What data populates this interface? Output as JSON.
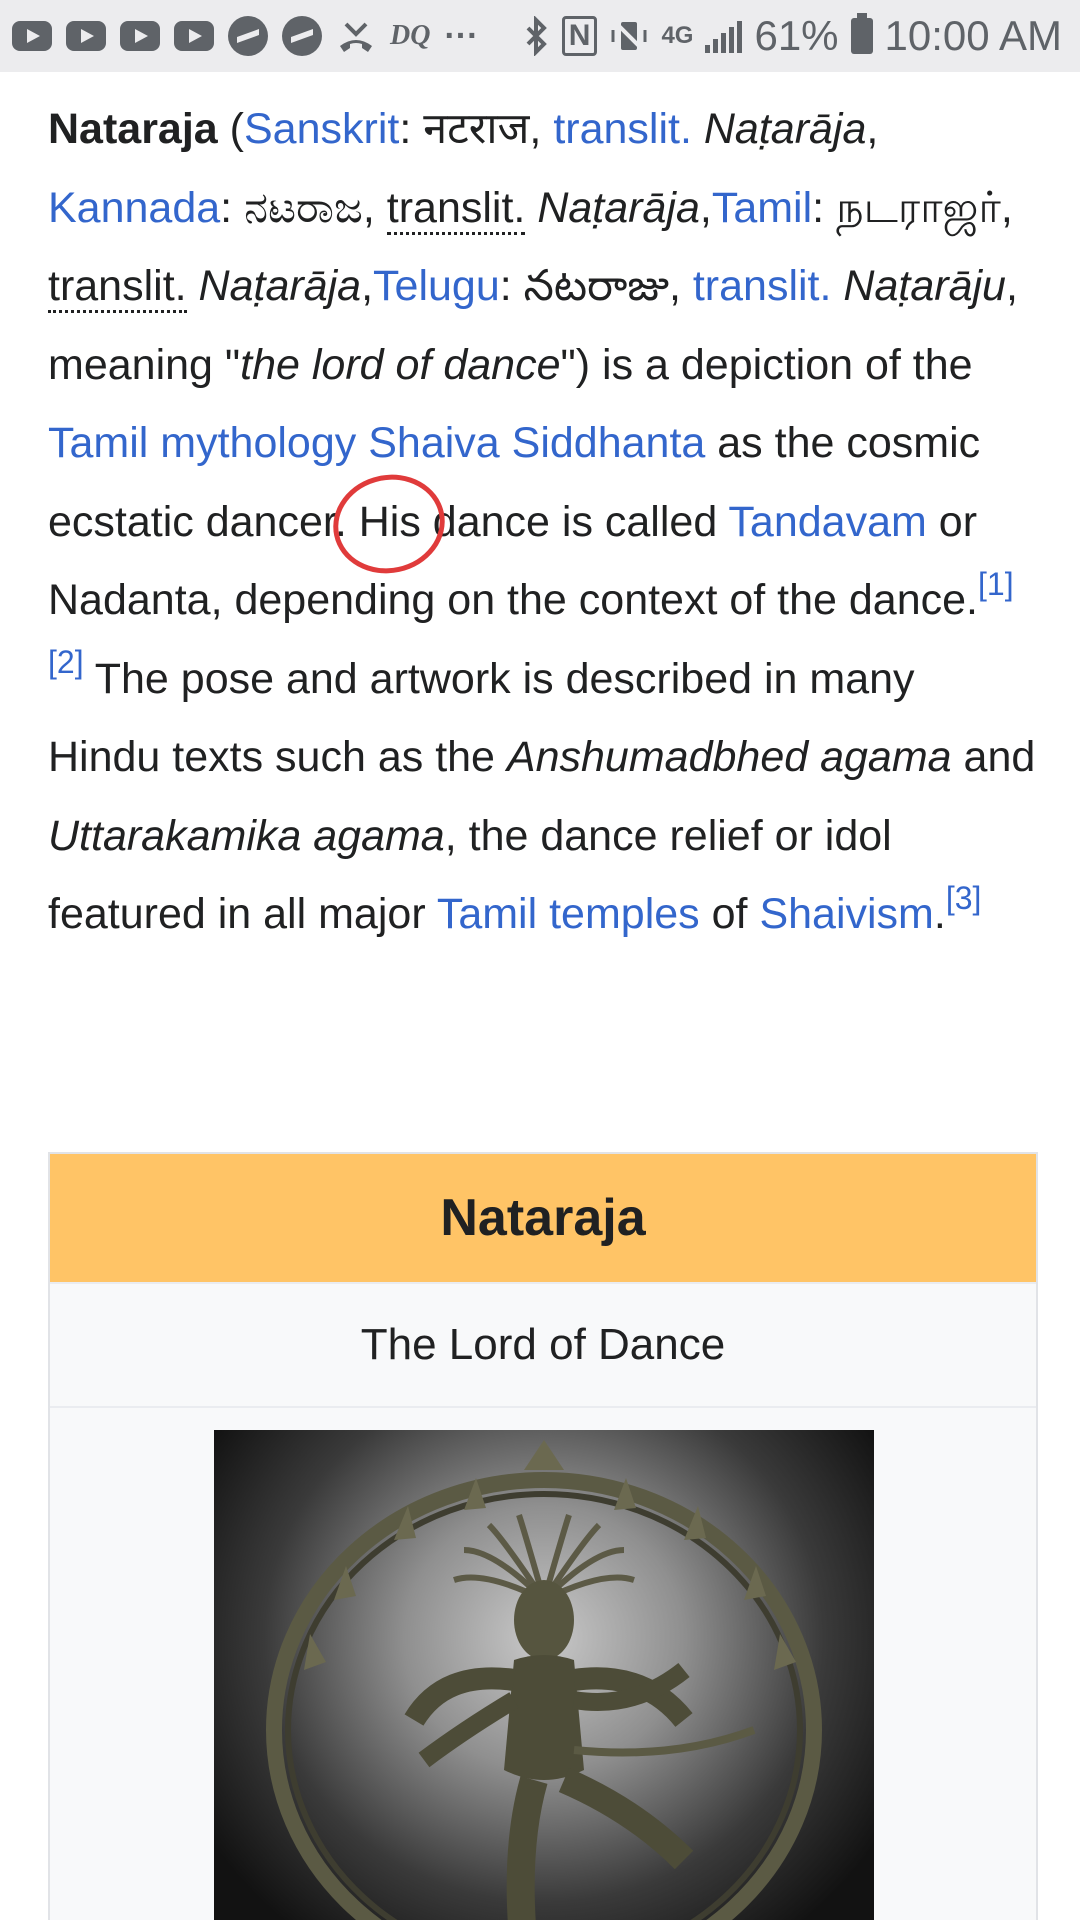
{
  "status_bar": {
    "dq_label": "DQ",
    "more_label": "···",
    "nfc_label": "N",
    "network_label": "4G",
    "battery_percent": "61%",
    "time": "10:00 AM"
  },
  "article": {
    "p1": {
      "title": "Nataraja",
      "open_paren": " (",
      "sanskrit_link": "Sanskrit",
      "sanskrit_text": ": नटराज, ",
      "translit_1": "translit.",
      "nataraja_1": " Naṭarāja",
      "comma_1": ",",
      "kannada_link": "Kannada",
      "kannada_text": ": ನಟರಾಜ, ",
      "translit_2": "translit.",
      "nataraja_2": " Naṭarāja",
      "comma_2": ",",
      "tamil_link": "Tamil",
      "tamil_text": ": நடராஜர், ",
      "translit_3": "translit.",
      "nataraja_3": " Naṭarāja",
      "comma_3": ",",
      "telugu_link": "Telugu",
      "telugu_text": ": నటరాజు, ",
      "translit_4": "translit.",
      "natarju": " Naṭarāju",
      "meaning": ", meaning \"",
      "lord_of_dance": "the lord of dance",
      "close": "\") is a depiction of the ",
      "tamil_mythology_link": "Tamil mythology",
      "space": " ",
      "shaiva_link": "Shaiva Siddhanta",
      "cosmic": " as the cosmic ecstatic dancer. ",
      "his": "His",
      "dance_called": " dance is called ",
      "tandavam_link": "Tandavam",
      "nadanta": " or Nadanta, depending on the context of the dance.",
      "ref1": "[1]",
      "ref2": "[2]",
      "pose": " The pose and artwork is described in many Hindu texts such as the ",
      "anshumadbhed": "Anshumadbhed agama",
      "and": " and ",
      "uttarakamika": "Uttarakamika agama",
      "relief": ", the dance relief or idol featured in all major ",
      "tamil_temples_link": "Tamil temples",
      "of": " of ",
      "shaivism_link": "Shaivism",
      "period": ".",
      "ref3": "[3]"
    }
  },
  "infobox": {
    "title": "Nataraja",
    "subtitle": "The Lord of Dance"
  },
  "colors": {
    "link": "#3366cc",
    "redlink": "#dd3333",
    "infobox_header": "#ffc466",
    "annotation": "#e03b3b"
  }
}
